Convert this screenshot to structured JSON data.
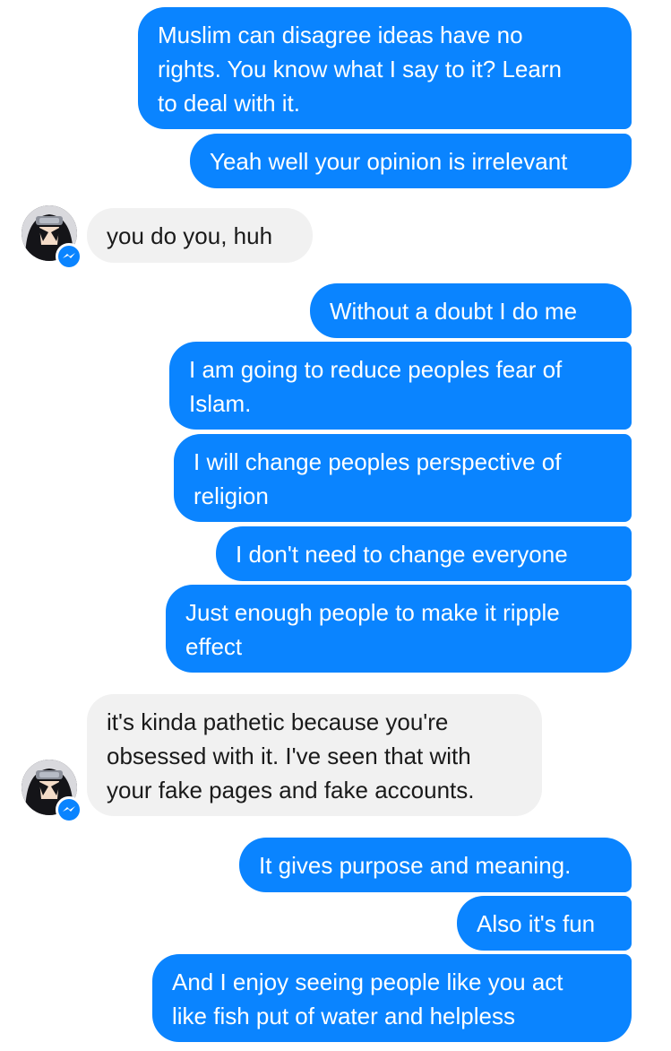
{
  "conversation": {
    "messages": [
      {
        "from": "me",
        "text": "Muslim can disagree ideas have no\nrights. You know what I say to it? Learn\nto deal with it."
      },
      {
        "from": "me",
        "text": "Yeah well your opinion is irrelevant"
      },
      {
        "from": "them",
        "text": "you do you, huh"
      },
      {
        "from": "me",
        "text": "Without a doubt I do me"
      },
      {
        "from": "me",
        "text": "I am going to reduce peoples fear of\nIslam."
      },
      {
        "from": "me",
        "text": "I will change peoples perspective of\nreligion"
      },
      {
        "from": "me",
        "text": "I don't need to change everyone"
      },
      {
        "from": "me",
        "text": "Just enough people to make it ripple\neffect"
      },
      {
        "from": "them",
        "text": "it's kinda pathetic because you're\nobsessed with it. I've seen that with\nyour fake pages and fake accounts."
      },
      {
        "from": "me",
        "text": "It gives purpose and meaning."
      },
      {
        "from": "me",
        "text": "Also it's fun"
      },
      {
        "from": "me",
        "text": "And I enjoy seeing people like you act\nlike fish put of water and helpless"
      }
    ]
  },
  "colors": {
    "outgoing_bubble": "#0a84ff",
    "incoming_bubble": "#f1f1f1",
    "messenger_badge": "#0a84ff"
  },
  "icons": {
    "avatar": "contact-avatar",
    "badge": "messenger-icon"
  }
}
